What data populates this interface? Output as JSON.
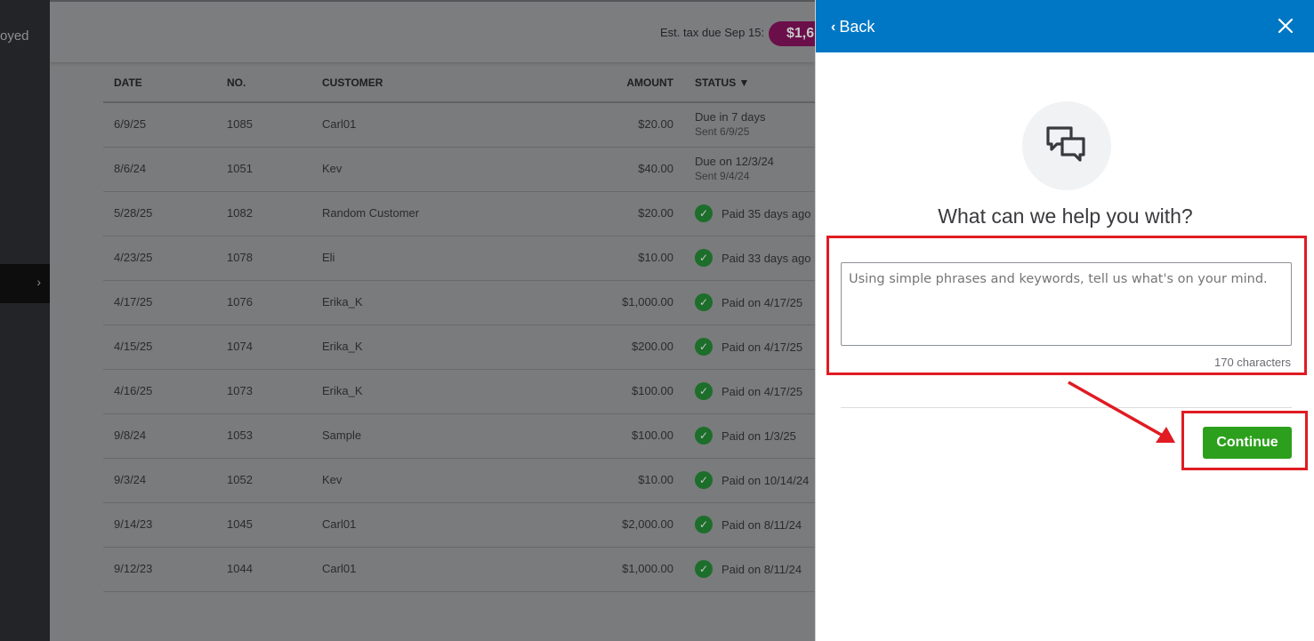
{
  "nav": {
    "partial_text": "oyed"
  },
  "topbar": {
    "est_tax_label": "Est. tax due Sep 15:",
    "est_tax_badge": "$1,6"
  },
  "table": {
    "headers": {
      "date": "DATE",
      "no": "NO.",
      "customer": "CUSTOMER",
      "amount": "AMOUNT",
      "status": "STATUS ▼"
    },
    "rows": [
      {
        "date": "6/9/25",
        "no": "1085",
        "customer": "Carl01",
        "amount": "$20.00",
        "status": "Due in 7 days",
        "status_sub": "Sent 6/9/25",
        "paid": false
      },
      {
        "date": "8/6/24",
        "no": "1051",
        "customer": "Kev",
        "amount": "$40.00",
        "status": "Due on 12/3/24",
        "status_sub": "Sent 9/4/24",
        "paid": false
      },
      {
        "date": "5/28/25",
        "no": "1082",
        "customer": "Random Customer",
        "amount": "$20.00",
        "status": "Paid 35 days ago",
        "paid": true
      },
      {
        "date": "4/23/25",
        "no": "1078",
        "customer": "Eli",
        "amount": "$10.00",
        "status": "Paid 33 days ago",
        "paid": true
      },
      {
        "date": "4/17/25",
        "no": "1076",
        "customer": "Erika_K",
        "amount": "$1,000.00",
        "status": "Paid on 4/17/25",
        "paid": true
      },
      {
        "date": "4/15/25",
        "no": "1074",
        "customer": "Erika_K",
        "amount": "$200.00",
        "status": "Paid on 4/17/25",
        "paid": true
      },
      {
        "date": "4/16/25",
        "no": "1073",
        "customer": "Erika_K",
        "amount": "$100.00",
        "status": "Paid on 4/17/25",
        "paid": true
      },
      {
        "date": "9/8/24",
        "no": "1053",
        "customer": "Sample",
        "amount": "$100.00",
        "status": "Paid on 1/3/25",
        "paid": true
      },
      {
        "date": "9/3/24",
        "no": "1052",
        "customer": "Kev",
        "amount": "$10.00",
        "status": "Paid on 10/14/24",
        "paid": true
      },
      {
        "date": "9/14/23",
        "no": "1045",
        "customer": "Carl01",
        "amount": "$2,000.00",
        "status": "Paid on 8/11/24",
        "paid": true
      },
      {
        "date": "9/12/23",
        "no": "1044",
        "customer": "Carl01",
        "amount": "$1,000.00",
        "status": "Paid on 8/11/24",
        "paid": true
      }
    ]
  },
  "panel": {
    "back_label": "Back",
    "title": "What can we help you with?",
    "textarea_placeholder": "Using simple phrases and keywords, tell us what's on your mind.",
    "char_count": "170 characters",
    "continue_label": "Continue"
  },
  "colors": {
    "header_blue": "#0077c5",
    "continue_green": "#2ca01c",
    "annotation_red": "#e01b22",
    "paid_check": "#1c6e2a"
  },
  "icons": {
    "back": "chevron-left-icon",
    "close": "close-icon",
    "help": "chat-bubbles-icon",
    "paid": "checkmark-icon"
  }
}
